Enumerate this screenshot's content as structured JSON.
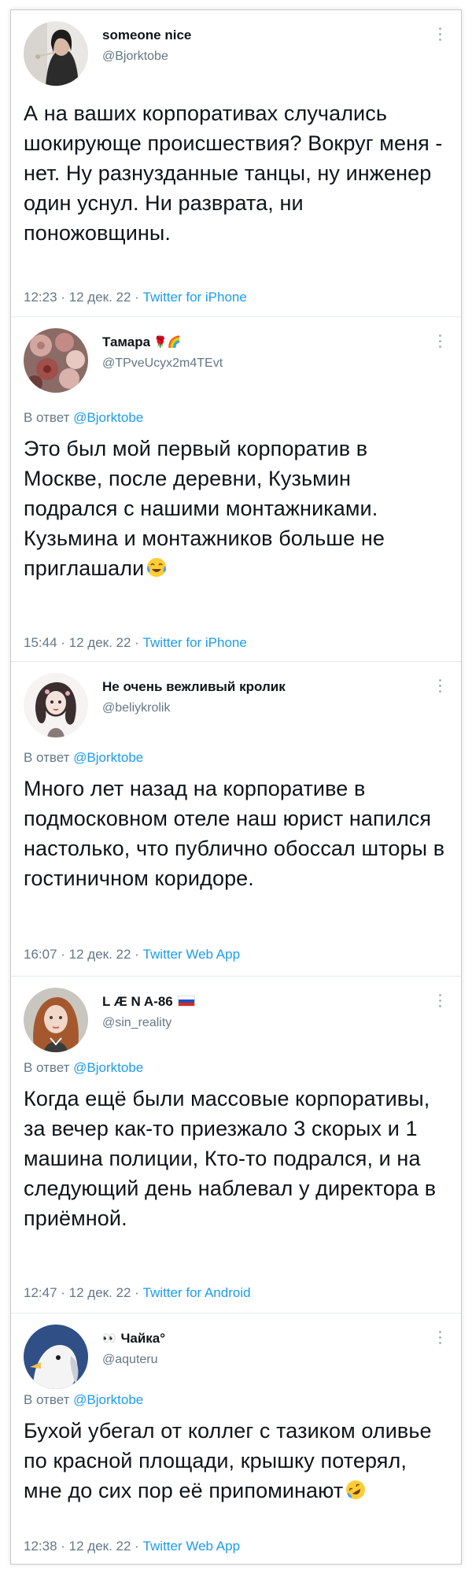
{
  "tweets": [
    {
      "name": "someone nice",
      "name_badge": "",
      "handle": "@Bjorktobe",
      "reply_prefix": "",
      "reply_mention": "",
      "text": "А на ваших корпоративах случались шокирующе происшествия? Вокруг меня - нет. Ну разнузданные танцы, ну инженер один уснул. Ни разврата, ни поножовщины.",
      "time_date": "12:23 · 12 дек. 22 · ",
      "source": "Twitter for iPhone",
      "avatar": "avatar-woman-dark"
    },
    {
      "name": "Тамара",
      "name_badge": "🌹🌈",
      "handle": "@TPveUcyx2m4TEvt",
      "reply_prefix": "В ответ ",
      "reply_mention": "@Bjorktobe",
      "text": "Это был мой первый корпоратив в Москве, после деревни, Кузьмин подрался с нашими монтажниками. Кузьмина и монтажников больше не приглашали",
      "emoji": "face-with-tears-of-joy",
      "time_date": "15:44 · 12 дек. 22 · ",
      "source": "Twitter for iPhone",
      "avatar": "avatar-flowers"
    },
    {
      "name": "Не очень вежливый кролик",
      "name_badge": "",
      "handle": "@beliykrolik",
      "reply_prefix": "В ответ ",
      "reply_mention": "@Bjorktobe",
      "text": "Много лет назад на корпоративе в подмосковном отеле наш юрист напился настолько, что публично обоссал шторы в гостиничном коридоре.",
      "time_date": "16:07 · 12 дек. 22 · ",
      "source": "Twitter Web App",
      "avatar": "avatar-illustrated-girl"
    },
    {
      "name": "L Æ N A-86",
      "name_badge": "flag-russia",
      "handle": "@sin_reality",
      "reply_prefix": "В ответ ",
      "reply_mention": "@Bjorktobe",
      "text": "Когда ещё были массовые корпоративы, за вечер как-то приезжало 3 скорых и 1 машина полиции, Кто-то подрался, и на следующий день наблевал у директора в приёмной.",
      "time_date": "12:47 · 12 дек. 22 · ",
      "source": "Twitter for Android",
      "avatar": "avatar-redhead-portrait"
    },
    {
      "name": "Чайка°",
      "name_badge": "👀",
      "handle": "@aquteru",
      "reply_prefix": "В ответ ",
      "reply_mention": "@Bjorktobe",
      "text": "Бухой убегал от коллег с тазиком оливье по красной площади, крышку потерял, мне до сих пор её припоминают",
      "emoji": "rolling-on-the-floor-laughing",
      "time_date": "12:38 · 12 дек. 22 · ",
      "source": "Twitter Web App",
      "avatar": "avatar-seagull"
    }
  ],
  "colors": {
    "link": "#1d9bf0",
    "secondary": "#657786",
    "text": "#0f1419",
    "divider": "#e6ecf0"
  }
}
